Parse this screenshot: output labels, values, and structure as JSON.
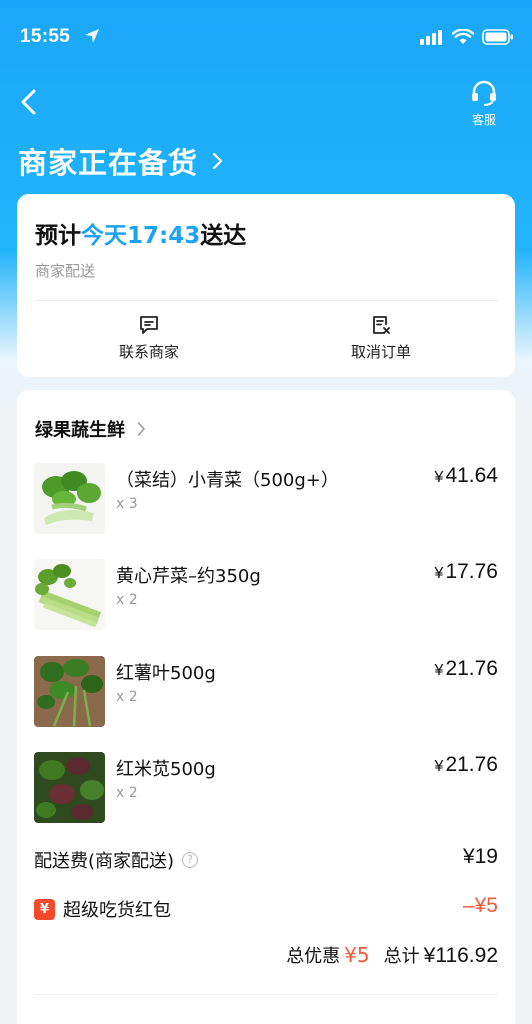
{
  "status_bar": {
    "time": "15:55"
  },
  "nav": {
    "service_label": "客服"
  },
  "page": {
    "title": "商家正在备货"
  },
  "delivery": {
    "eta_prefix": "预计",
    "eta_time": "今天17:43",
    "eta_suffix": "送达",
    "method": "商家配送",
    "actions": [
      {
        "label": "联系商家",
        "icon": "message-icon"
      },
      {
        "label": "取消订单",
        "icon": "cancel-order-icon"
      }
    ]
  },
  "order": {
    "shop_name": "绿果蔬生鲜",
    "currency": "¥",
    "items": [
      {
        "name": "（菜结）小青菜（500g+）",
        "qty": "x 3",
        "price": "41.64"
      },
      {
        "name": "黄心芹菜–约350g",
        "qty": "x 2",
        "price": "17.76"
      },
      {
        "name": "红薯叶500g",
        "qty": "x 2",
        "price": "21.76"
      },
      {
        "name": "红米苋500g",
        "qty": "x 2",
        "price": "21.76"
      }
    ],
    "delivery_fee_label": "配送费(商家配送)",
    "delivery_fee": "¥19",
    "redpack_badge": "¥",
    "redpack_label": "超级吃货红包",
    "redpack_value": "–¥5",
    "discount_label": "总优惠",
    "discount_value": "¥5",
    "total_label": "总计",
    "total_value": "¥116.92"
  },
  "colors": {
    "accent": "#1aa3f2",
    "discount": "#f45a3c",
    "header_gradient": "#1aa7f7"
  }
}
